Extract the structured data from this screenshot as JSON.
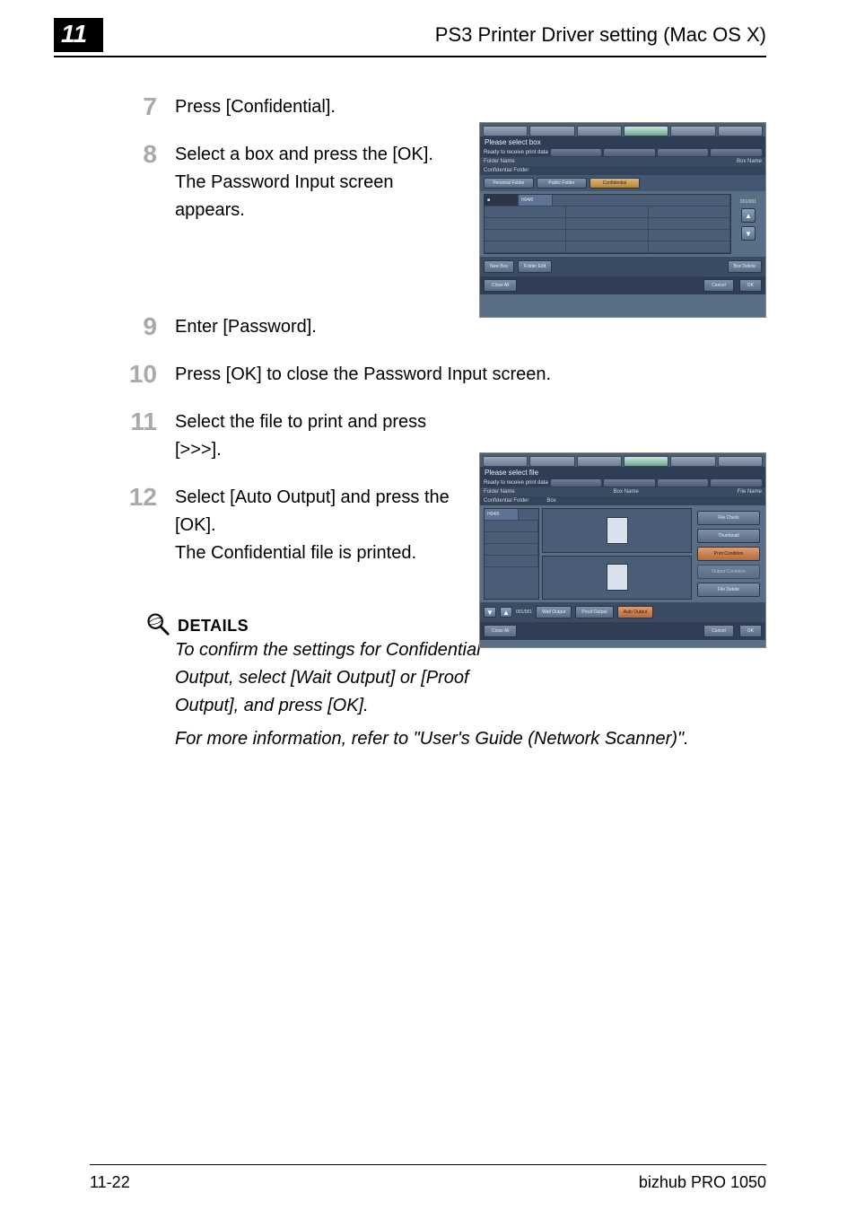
{
  "header": {
    "chapter_number": "11",
    "title": "PS3 Printer Driver setting (Mac OS X)"
  },
  "steps": {
    "s7": {
      "num": "7",
      "text": "Press [Confidential]."
    },
    "s8": {
      "num": "8",
      "text": "Select a box and press the [OK]. The Password Input screen appears."
    },
    "s9": {
      "num": "9",
      "text": "Enter [Password]."
    },
    "s10": {
      "num": "10",
      "text": "Press [OK] to close the Password Input screen."
    },
    "s11": {
      "num": "11",
      "text": "Select the file to print and press [>>>]."
    },
    "s12": {
      "num": "12",
      "text_line1": "Select [Auto Output] and press the [OK].",
      "text_line2": "The Confidential file is printed."
    }
  },
  "details": {
    "heading": "DETAILS",
    "para1": "To confirm the settings for Confidential Output, select [Wait Output] or [Proof Output], and press [OK].",
    "para2": "For more information, refer to \"User's Guide (Network Scanner)\"."
  },
  "panel1": {
    "title": "Please select box",
    "status": "Ready to receive print data",
    "col1": "Folder Name",
    "col2": "Box Name",
    "row_label": "Confidential Folder",
    "subtabs": {
      "a": "Personal Folder",
      "b": "Public Folder",
      "c": "Confidential"
    },
    "cell_label": "H04/0",
    "counter": "001/001",
    "up": "▲",
    "down": "▼",
    "btn_newbox": "New Box",
    "btn_folder": "Folder Edit",
    "btn_boxdel": "Box Delete",
    "btn_close": "Close All",
    "btn_cancel": "Cancel",
    "btn_ok": "OK"
  },
  "panel2": {
    "title": "Please select file",
    "status": "Ready to receive print data",
    "col1": "Folder Name",
    "col2": "Box Name",
    "col3": "File Name",
    "row_label": "Confidential Folder",
    "sub_label": "Box",
    "cell_label": "H04/0",
    "counter": "001/001",
    "up": "▲",
    "down": "▼",
    "rbtn_file": "File Check",
    "rbtn_thumb": "Thumbnail",
    "rbtn_printcond": "Print Condition",
    "rbtn_output": "Output Condition",
    "rbtn_filedel": "File Delete",
    "bbtn_wait": "Wait Output",
    "bbtn_proof": "Proof Output",
    "bbtn_auto": "Auto Output",
    "btn_close": "Close All",
    "btn_cancel": "Cancel",
    "btn_ok": "OK"
  },
  "footer": {
    "page": "11-22",
    "product": "bizhub PRO 1050"
  }
}
